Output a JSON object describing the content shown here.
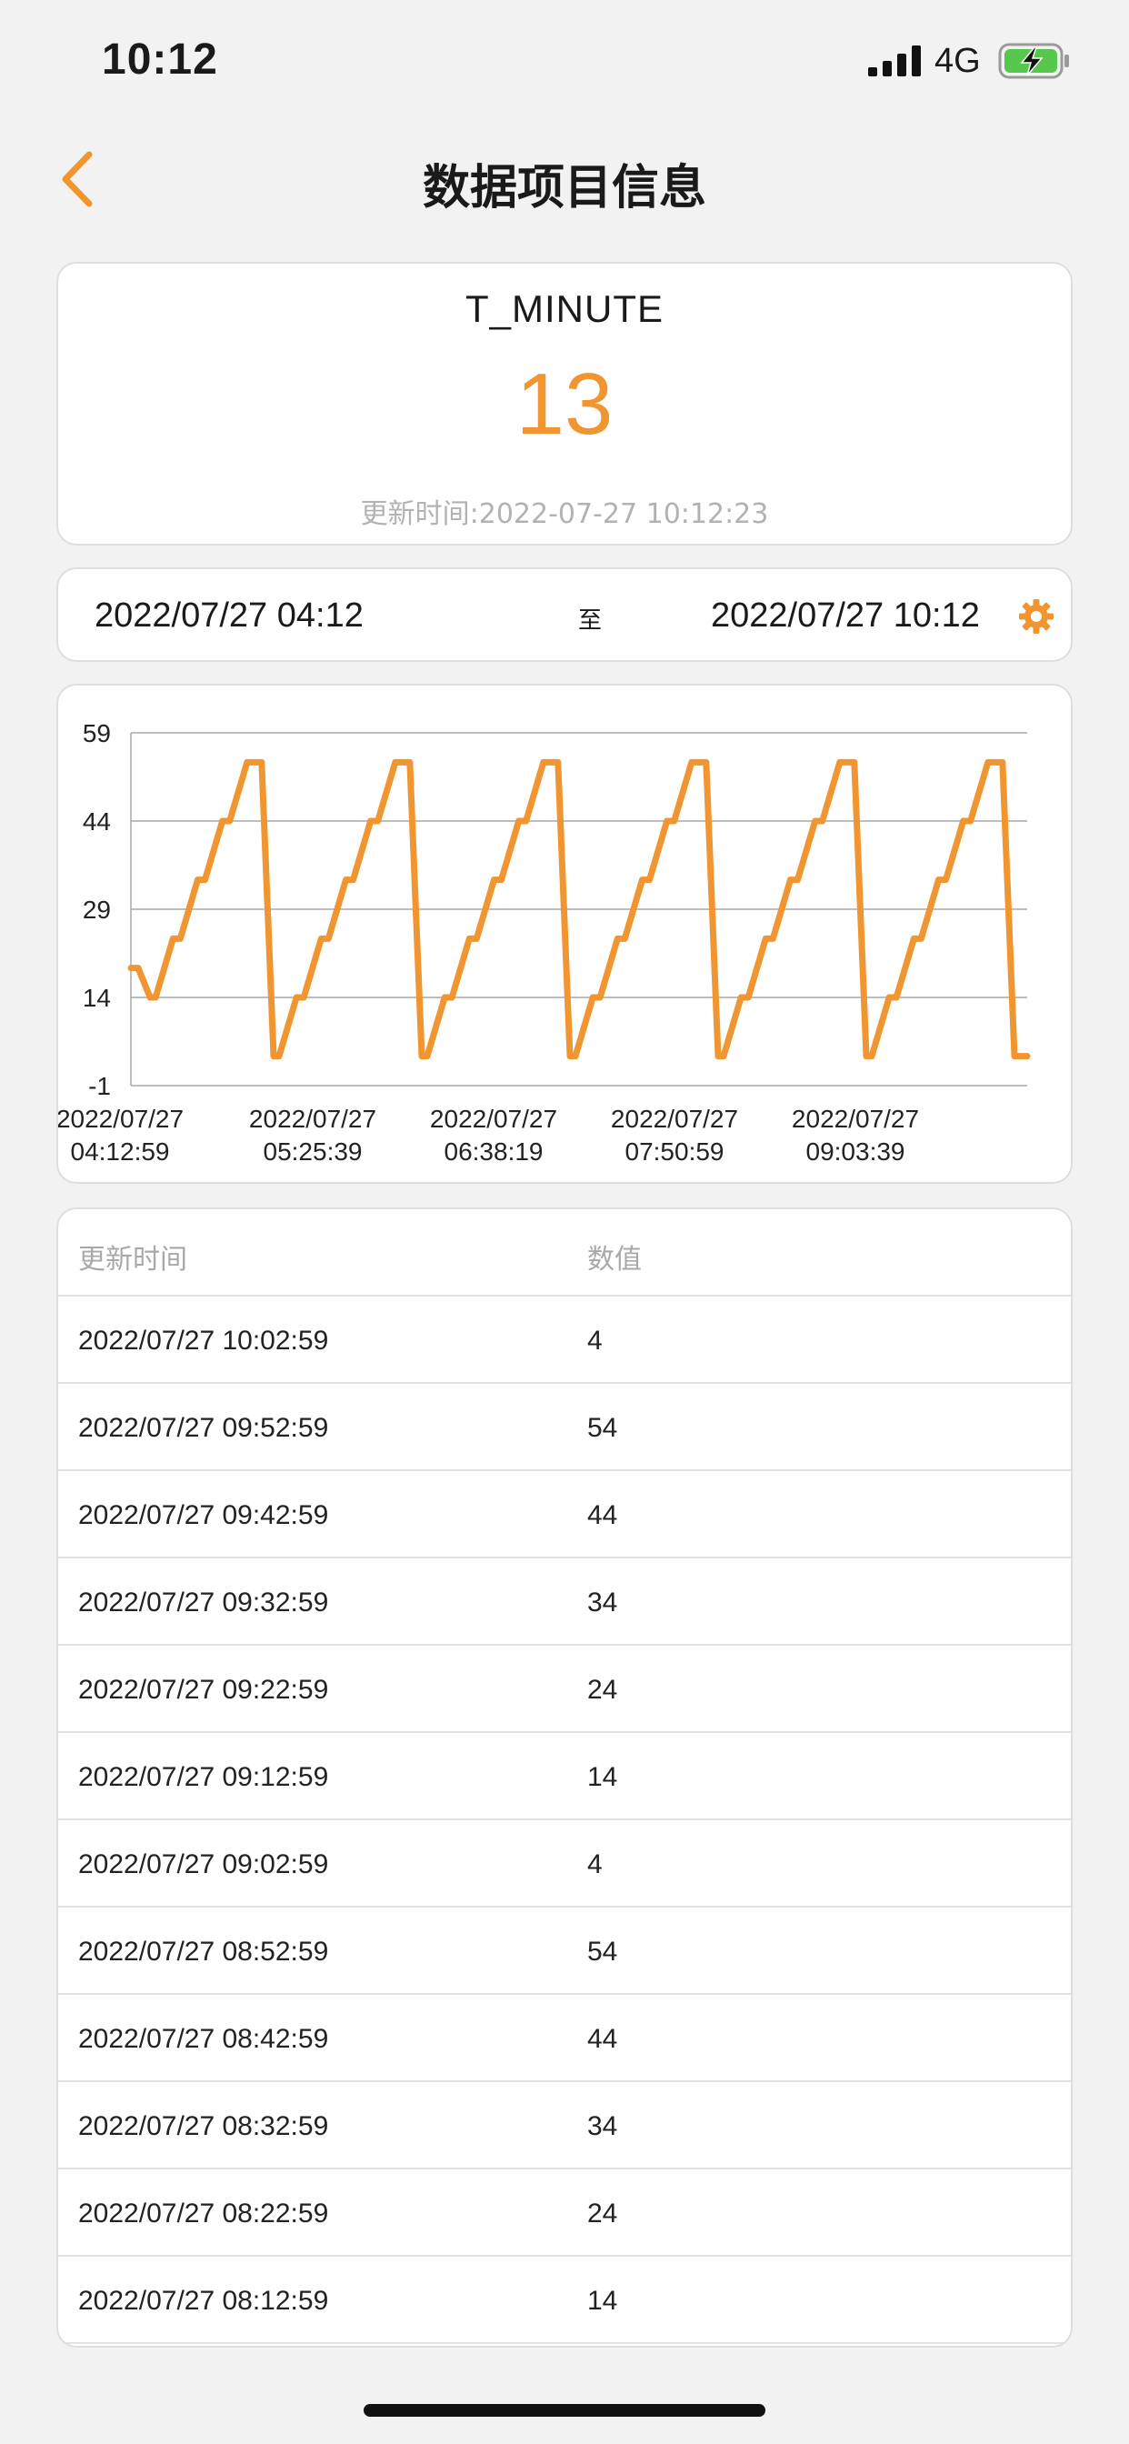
{
  "status_bar": {
    "time": "10:12",
    "network": "4G",
    "icons": [
      "signal-icon",
      "battery-charging-icon"
    ]
  },
  "nav": {
    "title": "数据项目信息",
    "back_icon": "chevron-left-icon"
  },
  "accent_color": "#f0952f",
  "item": {
    "name": "T_MINUTE",
    "value": "13",
    "update_time": "更新时间:2022-07-27 10:12:23"
  },
  "range": {
    "start": "2022/07/27 04:12",
    "separator": "至",
    "end": "2022/07/27 10:12",
    "settings_icon": "gear-icon"
  },
  "chart_data": {
    "type": "line",
    "y_ticks": [
      "59",
      "44",
      "29",
      "14",
      "-1"
    ],
    "ylim": [
      -1,
      59
    ],
    "x_tick_labels": [
      [
        "2022/07/27",
        "04:12:59"
      ],
      [
        "2022/07/27",
        "05:25:39"
      ],
      [
        "2022/07/27",
        "06:38:19"
      ],
      [
        "2022/07/27",
        "07:50:59"
      ],
      [
        "2022/07/27",
        "09:03:39"
      ]
    ],
    "grid": true,
    "series": [
      {
        "color": "#f0952f",
        "values": [
          19,
          14,
          24,
          34,
          44,
          54,
          4,
          14,
          24,
          34,
          44,
          54,
          4,
          14,
          24,
          34,
          44,
          54,
          4,
          14,
          24,
          34,
          44,
          54,
          4,
          14,
          24,
          34,
          44,
          54,
          4,
          14,
          24,
          34,
          44,
          54,
          4
        ]
      }
    ]
  },
  "table": {
    "headers": {
      "time": "更新时间",
      "value": "数值"
    },
    "rows": [
      {
        "time": "2022/07/27 10:02:59",
        "value": "4"
      },
      {
        "time": "2022/07/27 09:52:59",
        "value": "54"
      },
      {
        "time": "2022/07/27 09:42:59",
        "value": "44"
      },
      {
        "time": "2022/07/27 09:32:59",
        "value": "34"
      },
      {
        "time": "2022/07/27 09:22:59",
        "value": "24"
      },
      {
        "time": "2022/07/27 09:12:59",
        "value": "14"
      },
      {
        "time": "2022/07/27 09:02:59",
        "value": "4"
      },
      {
        "time": "2022/07/27 08:52:59",
        "value": "54"
      },
      {
        "time": "2022/07/27 08:42:59",
        "value": "44"
      },
      {
        "time": "2022/07/27 08:32:59",
        "value": "34"
      },
      {
        "time": "2022/07/27 08:22:59",
        "value": "24"
      },
      {
        "time": "2022/07/27 08:12:59",
        "value": "14"
      }
    ]
  }
}
